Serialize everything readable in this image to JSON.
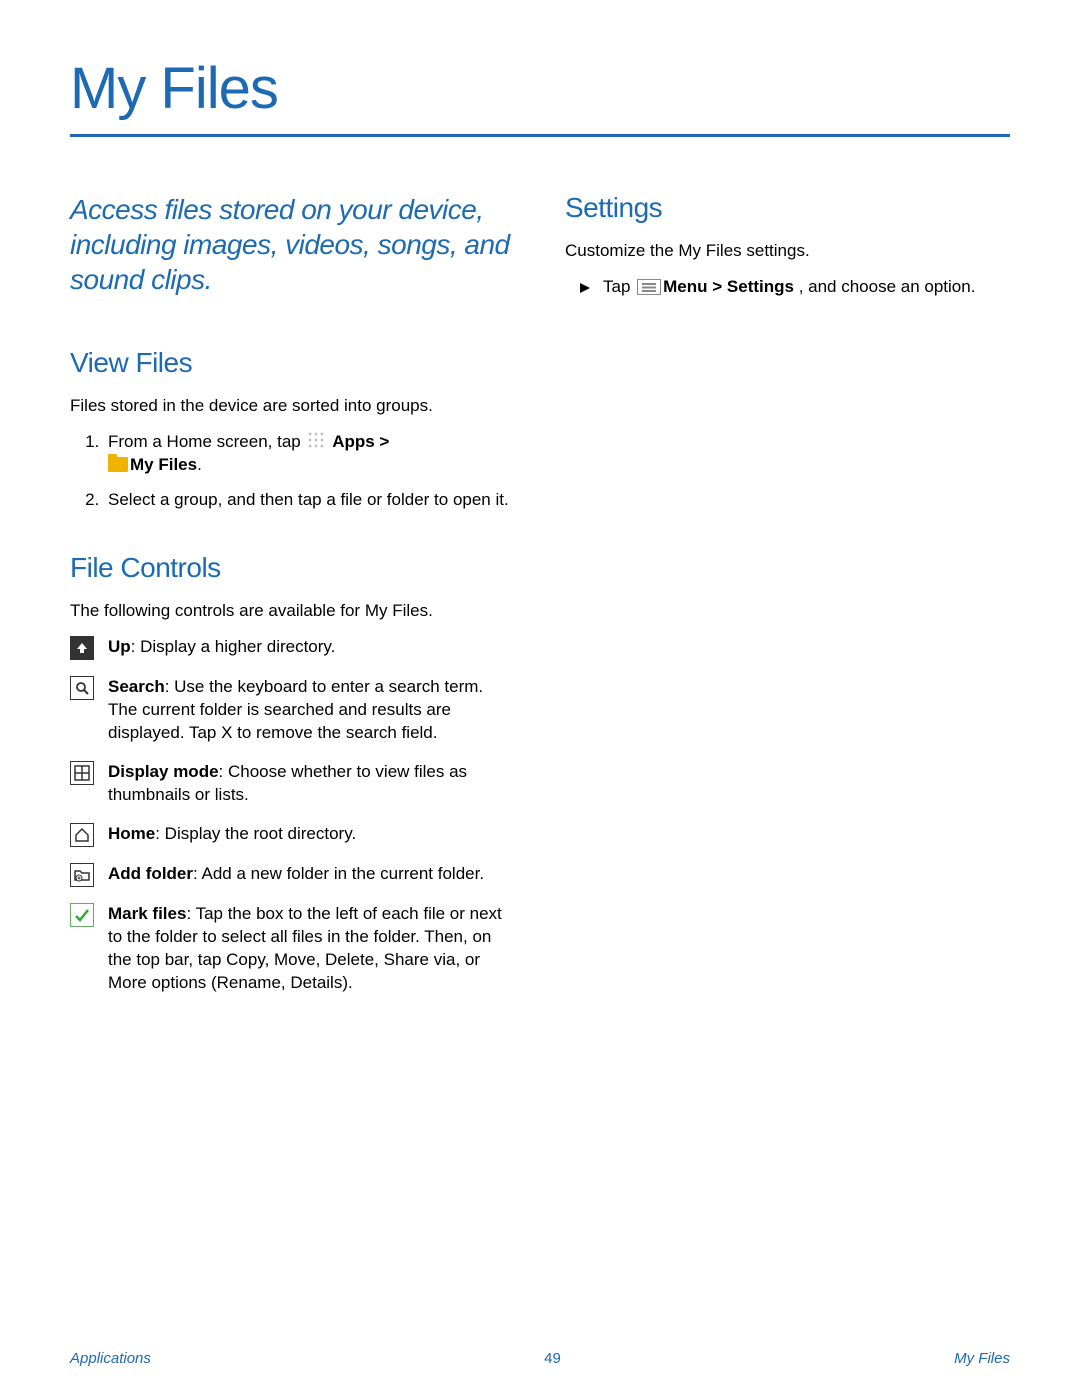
{
  "title": "My Files",
  "intro": "Access files stored on your device, including images, videos, songs, and sound clips.",
  "viewFiles": {
    "heading": "View Files",
    "lead": "Files stored in the device are sorted into groups.",
    "step1_a": "From a Home screen, tap ",
    "step1_apps": "Apps > ",
    "step1_myfiles": "My Files",
    "step1_period": ".",
    "step2": "Select a group, and then tap a file or folder to open it."
  },
  "fileControls": {
    "heading": "File Controls",
    "lead": "The following controls are available for My Files.",
    "items": [
      {
        "name": "Up",
        "desc": ": Display a higher directory."
      },
      {
        "name": "Search",
        "desc": ": Use the keyboard to enter a search term. The current folder is searched and results are displayed. Tap X to remove the search field."
      },
      {
        "name": "Display mode",
        "desc": ": Choose whether to view files as thumbnails or lists."
      },
      {
        "name": "Home",
        "desc": ": Display the root directory."
      },
      {
        "name": "Add folder",
        "desc": ": Add a new folder in the current folder."
      },
      {
        "name": "Mark files",
        "desc": ": Tap the box to the left of each file or next to the folder to select all files in the folder. Then, on the top bar, tap Copy, Move, Delete, Share via, or More options (Rename, Details)."
      }
    ]
  },
  "settings": {
    "heading": "Settings",
    "lead": "Customize the My Files settings.",
    "tap": "Tap ",
    "menuPath": "Menu > Settings ",
    "tail": ", and choose an option."
  },
  "footer": {
    "left": "Applications",
    "page": "49",
    "right": "My Files"
  }
}
